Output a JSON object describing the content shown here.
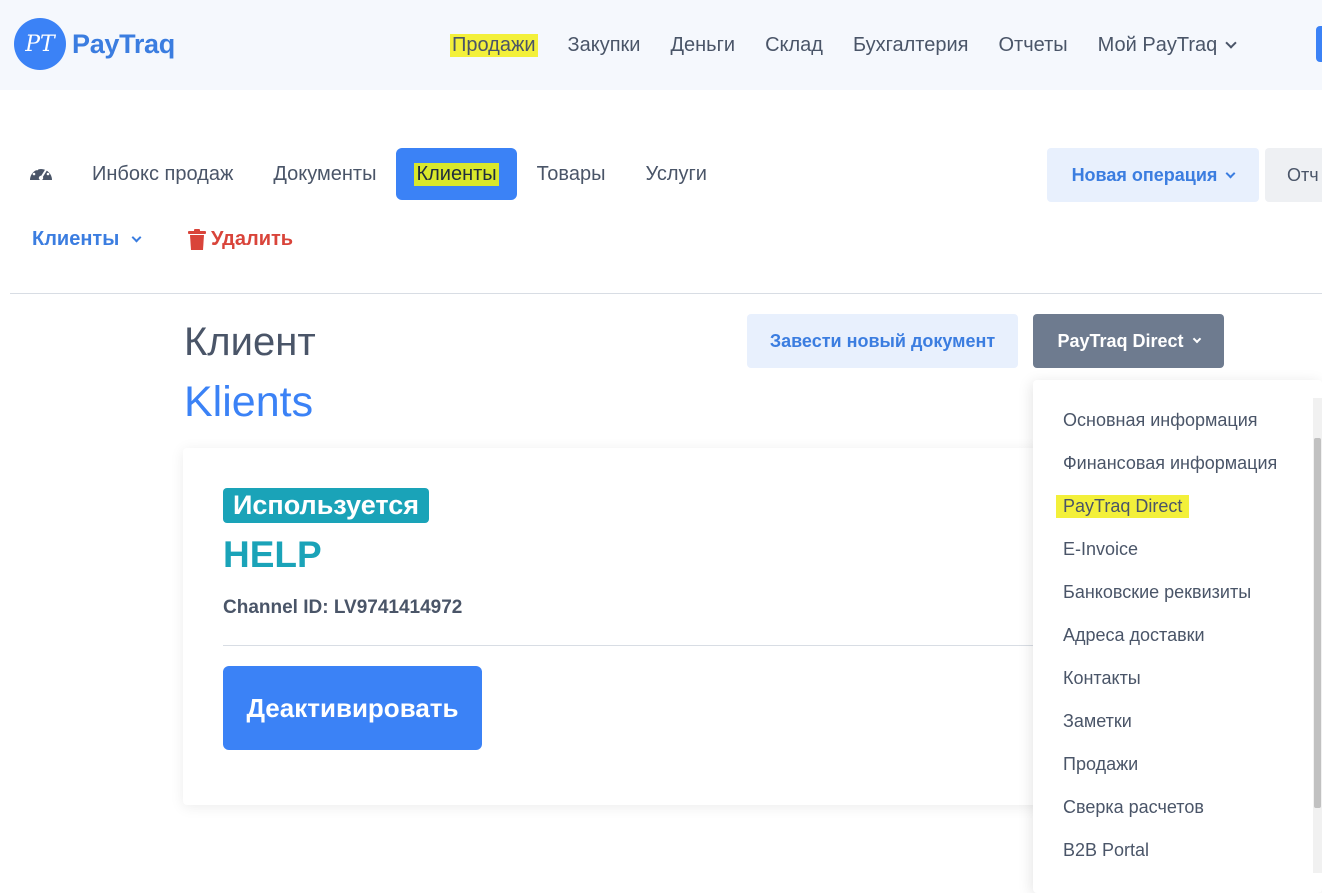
{
  "brand": {
    "name": "PayTraq",
    "mark": "PT",
    "color": "#3b82f6"
  },
  "top_nav": {
    "items": [
      "Продажи",
      "Закупки",
      "Деньги",
      "Склад",
      "Бухгалтерия",
      "Отчеты"
    ],
    "my_paytraq": "Мой PayTraq",
    "active": "Продажи"
  },
  "sub_nav": {
    "tabs": [
      "Инбокс продаж",
      "Документы",
      "Клиенты",
      "Товары",
      "Услуги"
    ],
    "active": "Клиенты",
    "new_operation": "Новая операция",
    "reports": "Отч"
  },
  "actions": {
    "clients_dropdown": "Клиенты",
    "delete": "Удалить"
  },
  "client": {
    "label": "Клиент",
    "name": "Klients",
    "new_document": "Завести новый документ",
    "direct_button": "PayTraq Direct"
  },
  "card": {
    "status": "Используется",
    "service": "HELP",
    "channel_id": "Channel ID: LV9741414972",
    "deactivate": "Деактивировать"
  },
  "menu": {
    "items": [
      "Основная информация",
      "Финансовая информация",
      "PayTraq Direct",
      "E-Invoice",
      "Банковские реквизиты",
      "Адреса доставки",
      "Контакты",
      "Заметки",
      "Продажи",
      "Сверка расчетов",
      "B2B Portal"
    ],
    "active": "PayTraq Direct"
  },
  "colors": {
    "accent": "#3b82f6",
    "teal": "#1aa3b8",
    "danger": "#d9443a",
    "highlight": "#f3f03a"
  }
}
